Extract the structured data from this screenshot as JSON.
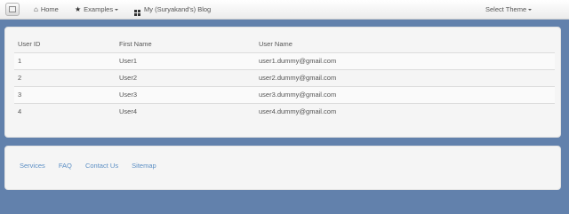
{
  "navbar": {
    "home_label": "Home",
    "examples_label": "Examples",
    "blog_label": "My (Suryakand's) Blog",
    "theme_label": "Select Theme",
    "icons": {
      "home": "home-icon",
      "examples": "star-icon",
      "blog": "grid-icon"
    }
  },
  "table": {
    "headers": [
      "User ID",
      "First Name",
      "User Name"
    ],
    "rows": [
      [
        "1",
        "User1",
        "user1.dummy@gmail.com"
      ],
      [
        "2",
        "User2",
        "user2.dummy@gmail.com"
      ],
      [
        "3",
        "User3",
        "user3.dummy@gmail.com"
      ],
      [
        "4",
        "User4",
        "user4.dummy@gmail.com"
      ]
    ]
  },
  "footer": {
    "links": [
      "Services",
      "FAQ",
      "Contact Us",
      "Sitemap"
    ]
  },
  "colors": {
    "page_background": "#6281ac",
    "panel_background": "#f5f5f5",
    "link": "#5b8ec4"
  }
}
